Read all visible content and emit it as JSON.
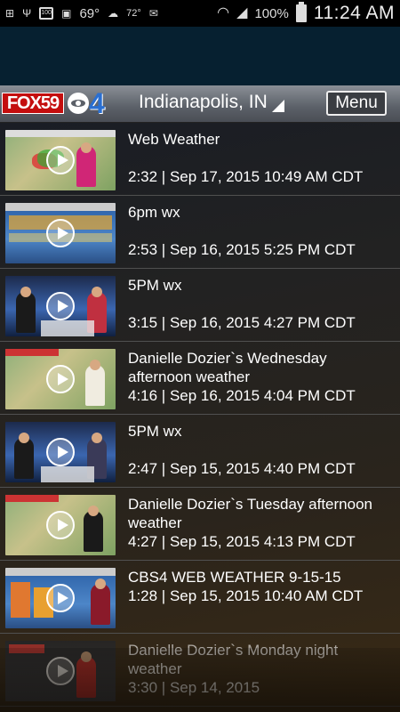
{
  "status_bar": {
    "signal_value": "69°",
    "weather_temp": "72°",
    "battery_small": "100",
    "battery_percent": "100%",
    "time": "11:24 AM"
  },
  "header": {
    "logo_fox": "FOX59",
    "logo_cbs4": "4",
    "city": "Indianapolis, IN",
    "menu_label": "Menu"
  },
  "videos": [
    {
      "title": "Web Weather",
      "meta": "2:32 | Sep 17, 2015 10:49 AM CDT",
      "thumb": "map"
    },
    {
      "title": "6pm wx",
      "meta": "2:53 | Sep 16, 2015 5:25 PM CDT",
      "thumb": "forecast"
    },
    {
      "title": "5PM wx",
      "meta": "3:15 | Sep 16, 2015 4:27 PM CDT",
      "thumb": "studio"
    },
    {
      "title": "Danielle Dozier`s Wednesday afternoon weather",
      "meta": "4:16 | Sep 16, 2015 4:04 PM CDT",
      "thumb": "map"
    },
    {
      "title": "5PM wx",
      "meta": "2:47 | Sep 15, 2015 4:40 PM CDT",
      "thumb": "studio"
    },
    {
      "title": "Danielle Dozier`s Tuesday afternoon weather",
      "meta": "4:27 | Sep 15, 2015 4:13 PM CDT",
      "thumb": "map"
    },
    {
      "title": "CBS4 WEB WEATHER 9-15-15",
      "meta": "1:28 | Sep 15, 2015 10:40 AM CDT",
      "thumb": "forecast"
    },
    {
      "title": "Danielle Dozier`s Monday night weather",
      "meta": "3:30 | Sep 14, 2015",
      "thumb": "dark"
    }
  ],
  "colors": {
    "fox_red": "#c40e0e",
    "cbs_blue": "#2a6fd1",
    "header_gray": "#5b6068"
  }
}
